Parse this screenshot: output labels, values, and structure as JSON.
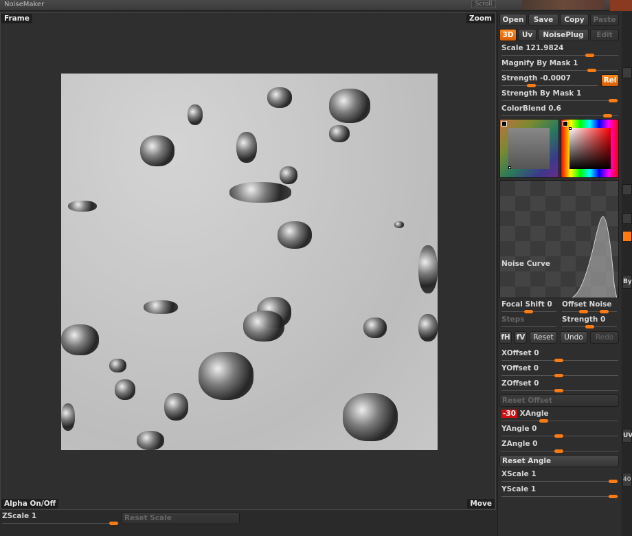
{
  "app": {
    "title": "NoiseMaker",
    "scroll_label": "Scroll"
  },
  "frame": {
    "top_left": "Frame",
    "top_right": "Zoom",
    "bottom_left": "Alpha On/Off",
    "bottom_right": "Move"
  },
  "toolbar": {
    "open": "Open",
    "save": "Save",
    "copy": "Copy",
    "paste": "Paste",
    "mode_3d": "3D",
    "uv": "Uv",
    "noiseplug": "NoisePlug",
    "edit": "Edit"
  },
  "sliders": {
    "scale": "Scale 121.9824",
    "magnify": "Magnify By Mask 1",
    "strength": "Strength -0.0007",
    "rel": "Rel",
    "strength_mask": "Strength By Mask 1",
    "colorblend": "ColorBlend 0.6"
  },
  "curve": {
    "label": "Noise Curve"
  },
  "params": {
    "focal_shift": "Focal Shift 0",
    "offset_noise": "Offset Noise",
    "steps": "Steps",
    "strength": "Strength 0"
  },
  "curve_buttons": {
    "fh": "fH",
    "fv": "fV",
    "reset": "Reset",
    "undo": "Undo",
    "redo": "Redo"
  },
  "offsets": {
    "x": "XOffset 0",
    "y": "YOffset 0",
    "z": "ZOffset 0",
    "reset": "Reset Offset"
  },
  "angles": {
    "x_value": "-30",
    "x_label": "XAngle",
    "y": "YAngle 0",
    "z": "ZAngle 0",
    "reset": "Reset Angle"
  },
  "scales": {
    "x": "XScale 1",
    "y": "YScale 1",
    "z": "ZScale 1",
    "reset": "Reset Scale"
  },
  "right_strip": {
    "by_label": "By",
    "uv_label": "UV",
    "num_label": "40"
  },
  "colors": {
    "accent": "#ff7a10",
    "panel": "#2e2e2e",
    "button": "#3f3f3f"
  }
}
